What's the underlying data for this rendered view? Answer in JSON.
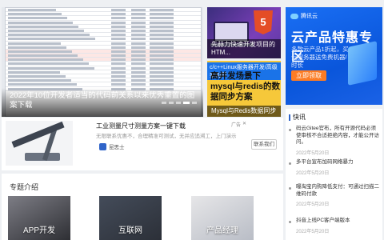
{
  "carousel": {
    "caption": "2022年10位开发者适当的代码前关系以来优秀重置的图案下载",
    "slide_count": 5,
    "active_index": 3
  },
  "promos": [
    {
      "title": "先赫力快速开发项目的HTM...",
      "icon": "html5-icon"
    },
    {
      "header": "c/c++Linux服务器开发/高级架构师",
      "headline": "高并发场景下mysql与redis的数据同步方案",
      "title": "Mysql与Redis数据同步"
    }
  ],
  "tencent_ad": {
    "logo": "腾讯云",
    "headline": "云产品特惠专区",
    "sub": "多款云产品1折起，买云服务器送免费机器/时长",
    "cta": "立即领取"
  },
  "text_ad": {
    "title": "工业测量尺寸测量方案一键下载",
    "desc": "无限联系优惠不，合理精准可测试，无并应追溯工，上门演示",
    "advertiser": "昆思士",
    "button": "联系我们",
    "label": "广告"
  },
  "topics": {
    "header": "专题介绍",
    "items": [
      {
        "label": "APP开发"
      },
      {
        "label": "互联网"
      },
      {
        "label": "产品经理"
      }
    ]
  },
  "news": {
    "header": "快讯",
    "items": [
      {
        "title": "码云Gitee官布，所有开源代码必须使审核不合适拒绝内容，才能公开访问。",
        "date": "2022年5月20日"
      },
      {
        "title": "多平台宣布加码网络暴力",
        "date": "2022年5月20日"
      },
      {
        "title": "曝淘宝内购降低支付：可通过扫描二维码付款",
        "date": "2022年5月20日"
      },
      {
        "title": "抖音上线PC客户端版本",
        "date": "2022年5月20日"
      }
    ]
  },
  "colors": {
    "accent": "#2f64c9",
    "tencent_blue": "#0a56db",
    "cta_orange": "#fd7c24",
    "mysql_yellow": "#f6c83a"
  }
}
